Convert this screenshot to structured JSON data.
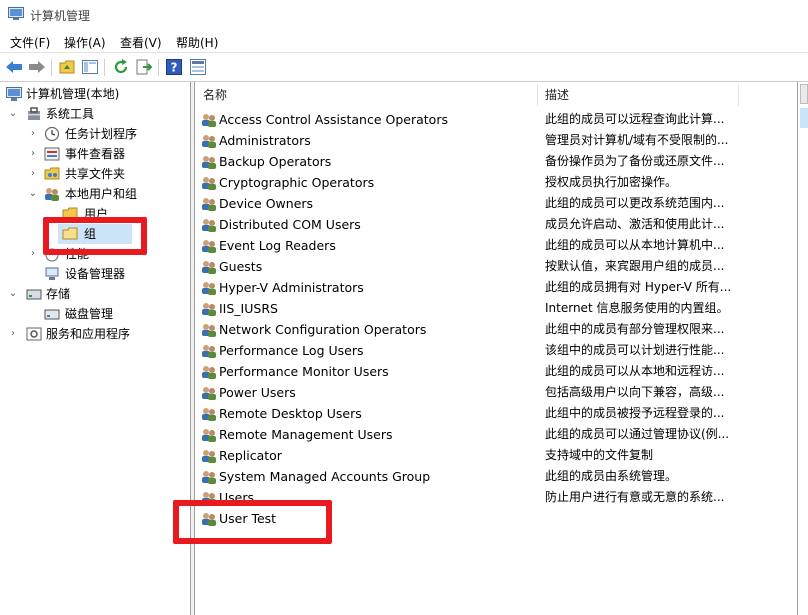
{
  "window": {
    "title": "计算机管理"
  },
  "menu": [
    "文件(F)",
    "操作(A)",
    "查看(V)",
    "帮助(H)"
  ],
  "toolbar": [
    "back-icon",
    "forward-icon",
    "up-folder-icon",
    "show-tree-icon",
    "refresh-icon",
    "export-icon",
    "help-icon",
    "properties-icon"
  ],
  "tree": {
    "root": "计算机管理(本地)",
    "system_tools": "系统工具",
    "task_scheduler": "任务计划程序",
    "event_viewer": "事件查看器",
    "shared_folders": "共享文件夹",
    "local_users_groups": "本地用户和组",
    "users": "用户",
    "groups": "组",
    "performance": "性能",
    "device_manager": "设备管理器",
    "storage": "存储",
    "disk_management": "磁盘管理",
    "services_apps": "服务和应用程序"
  },
  "list": {
    "col_name": "名称",
    "col_desc": "描述",
    "rows": [
      {
        "name": "Access Control Assistance Operators",
        "desc": "此组的成员可以远程查询此计算..."
      },
      {
        "name": "Administrators",
        "desc": "管理员对计算机/域有不受限制的..."
      },
      {
        "name": "Backup Operators",
        "desc": "备份操作员为了备份或还原文件..."
      },
      {
        "name": "Cryptographic Operators",
        "desc": "授权成员执行加密操作。"
      },
      {
        "name": "Device Owners",
        "desc": "此组的成员可以更改系统范围内..."
      },
      {
        "name": "Distributed COM Users",
        "desc": "成员允许启动、激活和使用此计..."
      },
      {
        "name": "Event Log Readers",
        "desc": "此组的成员可以从本地计算机中..."
      },
      {
        "name": "Guests",
        "desc": "按默认值，来宾跟用户组的成员..."
      },
      {
        "name": "Hyper-V Administrators",
        "desc": "此组的成员拥有对 Hyper-V 所有..."
      },
      {
        "name": "IIS_IUSRS",
        "desc": "Internet 信息服务使用的内置组。"
      },
      {
        "name": "Network Configuration Operators",
        "desc": "此组中的成员有部分管理权限来..."
      },
      {
        "name": "Performance Log Users",
        "desc": "该组中的成员可以计划进行性能..."
      },
      {
        "name": "Performance Monitor Users",
        "desc": "此组的成员可以从本地和远程访..."
      },
      {
        "name": "Power Users",
        "desc": "包括高级用户以向下兼容，高级..."
      },
      {
        "name": "Remote Desktop Users",
        "desc": "此组中的成员被授予远程登录的..."
      },
      {
        "name": "Remote Management Users",
        "desc": "此组的成员可以通过管理协议(例..."
      },
      {
        "name": "Replicator",
        "desc": "支持域中的文件复制"
      },
      {
        "name": "System Managed Accounts Group",
        "desc": "此组的成员由系统管理。"
      },
      {
        "name": "Users",
        "desc": "防止用户进行有意或无意的系统..."
      },
      {
        "name": "User Test",
        "desc": ""
      }
    ]
  },
  "annotation_color": "#e8191f"
}
